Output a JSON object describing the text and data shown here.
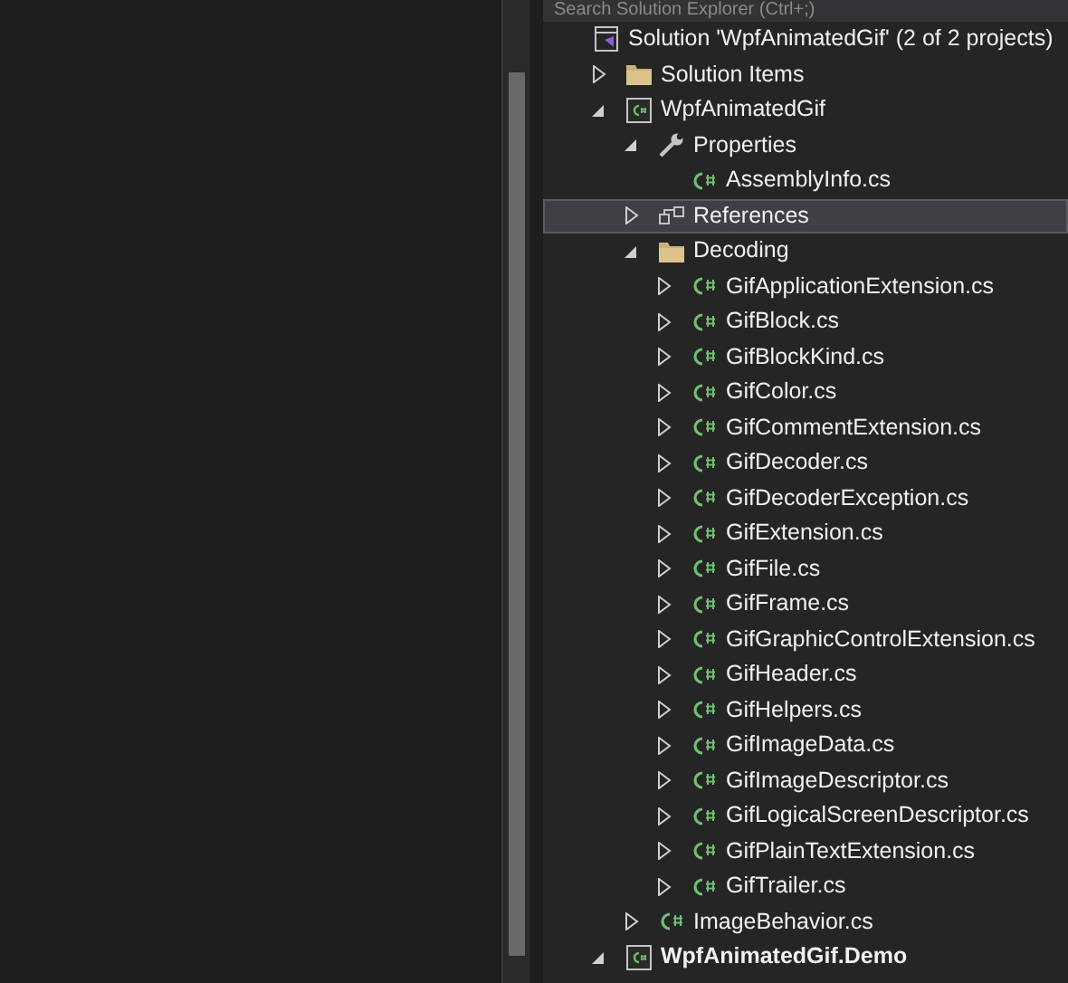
{
  "search": {
    "placeholder": "Search Solution Explorer (Ctrl+;)"
  },
  "tree": [
    {
      "kind": "solution",
      "label": "Solution 'WpfAnimatedGif' (2 of 2 projects)",
      "selected": false,
      "children": [
        {
          "kind": "folder",
          "label": "Solution Items",
          "expanded": false,
          "selected": false
        },
        {
          "kind": "project",
          "label": "WpfAnimatedGif",
          "startup": false,
          "expanded": true,
          "selected": false,
          "children": [
            {
              "kind": "properties",
              "label": "Properties",
              "expanded": true,
              "selected": false,
              "children": [
                {
                  "kind": "csharp",
                  "label": "AssemblyInfo.cs",
                  "selected": false
                }
              ]
            },
            {
              "kind": "references",
              "label": "References",
              "expanded": false,
              "selected": true
            },
            {
              "kind": "folder",
              "label": "Decoding",
              "expanded": true,
              "selected": false,
              "children": [
                {
                  "kind": "csharp",
                  "label": "GifApplicationExtension.cs",
                  "expanded": false,
                  "selected": false
                },
                {
                  "kind": "csharp",
                  "label": "GifBlock.cs",
                  "expanded": false,
                  "selected": false
                },
                {
                  "kind": "csharp",
                  "label": "GifBlockKind.cs",
                  "expanded": false,
                  "selected": false
                },
                {
                  "kind": "csharp",
                  "label": "GifColor.cs",
                  "expanded": false,
                  "selected": false
                },
                {
                  "kind": "csharp",
                  "label": "GifCommentExtension.cs",
                  "expanded": false,
                  "selected": false
                },
                {
                  "kind": "csharp",
                  "label": "GifDecoder.cs",
                  "expanded": false,
                  "selected": false
                },
                {
                  "kind": "csharp",
                  "label": "GifDecoderException.cs",
                  "expanded": false,
                  "selected": false
                },
                {
                  "kind": "csharp",
                  "label": "GifExtension.cs",
                  "expanded": false,
                  "selected": false
                },
                {
                  "kind": "csharp",
                  "label": "GifFile.cs",
                  "expanded": false,
                  "selected": false
                },
                {
                  "kind": "csharp",
                  "label": "GifFrame.cs",
                  "expanded": false,
                  "selected": false
                },
                {
                  "kind": "csharp",
                  "label": "GifGraphicControlExtension.cs",
                  "expanded": false,
                  "selected": false
                },
                {
                  "kind": "csharp",
                  "label": "GifHeader.cs",
                  "expanded": false,
                  "selected": false
                },
                {
                  "kind": "csharp",
                  "label": "GifHelpers.cs",
                  "expanded": false,
                  "selected": false
                },
                {
                  "kind": "csharp",
                  "label": "GifImageData.cs",
                  "expanded": false,
                  "selected": false
                },
                {
                  "kind": "csharp",
                  "label": "GifImageDescriptor.cs",
                  "expanded": false,
                  "selected": false
                },
                {
                  "kind": "csharp",
                  "label": "GifLogicalScreenDescriptor.cs",
                  "expanded": false,
                  "selected": false
                },
                {
                  "kind": "csharp",
                  "label": "GifPlainTextExtension.cs",
                  "expanded": false,
                  "selected": false
                },
                {
                  "kind": "csharp",
                  "label": "GifTrailer.cs",
                  "expanded": false,
                  "selected": false
                }
              ]
            },
            {
              "kind": "csharp",
              "label": "ImageBehavior.cs",
              "expanded": false,
              "selected": false
            }
          ]
        },
        {
          "kind": "project",
          "label": "WpfAnimatedGif.Demo",
          "startup": true,
          "expanded": true,
          "selected": false
        }
      ]
    }
  ]
}
